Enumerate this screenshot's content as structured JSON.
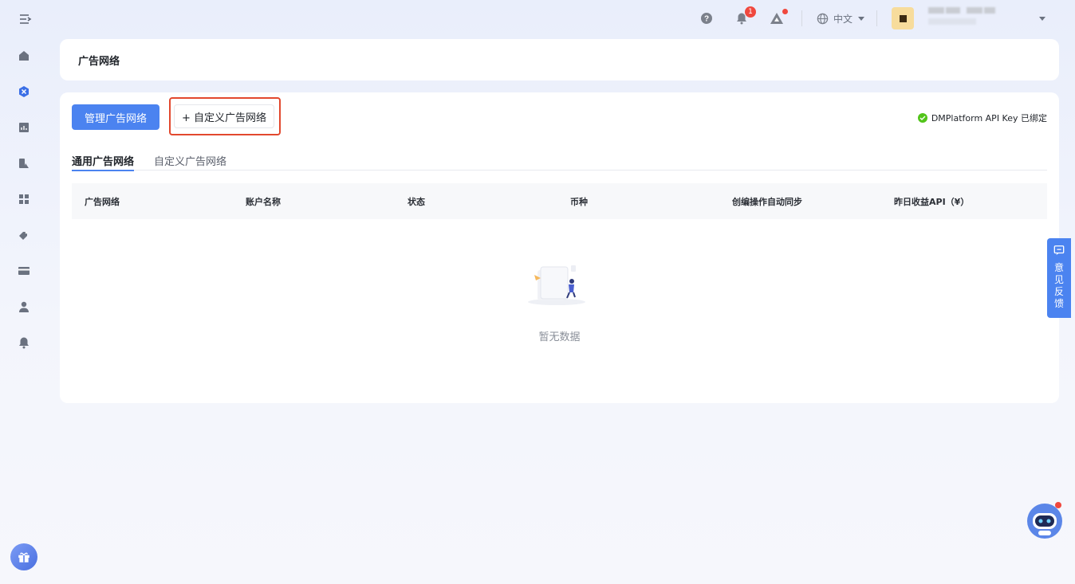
{
  "sidebar": {
    "toggle_icon": "menu-collapse-icon",
    "items": [
      {
        "icon": "home-icon"
      },
      {
        "icon": "ad-network-icon",
        "active": true
      },
      {
        "icon": "chart-icon"
      },
      {
        "icon": "apps-icon"
      },
      {
        "icon": "grid-icon"
      },
      {
        "icon": "tags-icon"
      },
      {
        "icon": "card-icon"
      },
      {
        "icon": "user-icon"
      },
      {
        "icon": "bell-icon"
      }
    ],
    "gift_icon": "gift-icon"
  },
  "header": {
    "notification_count": "1",
    "language": "中文"
  },
  "page": {
    "title": "广告网络"
  },
  "toolbar": {
    "manage_label": "管理广告网络",
    "custom_label": "+ 自定义广告网络",
    "api_key_status": "DMPlatform API Key 已绑定"
  },
  "tabs": [
    {
      "label": "通用广告网络",
      "active": true
    },
    {
      "label": "自定义广告网络",
      "active": false
    }
  ],
  "table": {
    "columns": [
      "广告网络",
      "账户名称",
      "状态",
      "币种",
      "创编操作自动同步",
      "昨日收益API（¥）"
    ],
    "rows": [],
    "empty_text": "暂无数据"
  },
  "feedback": {
    "label": "意见反馈"
  },
  "colors": {
    "primary": "#4b83f0",
    "highlight_border": "#e2482e",
    "success": "#52c41a",
    "badge": "#f0483e"
  }
}
